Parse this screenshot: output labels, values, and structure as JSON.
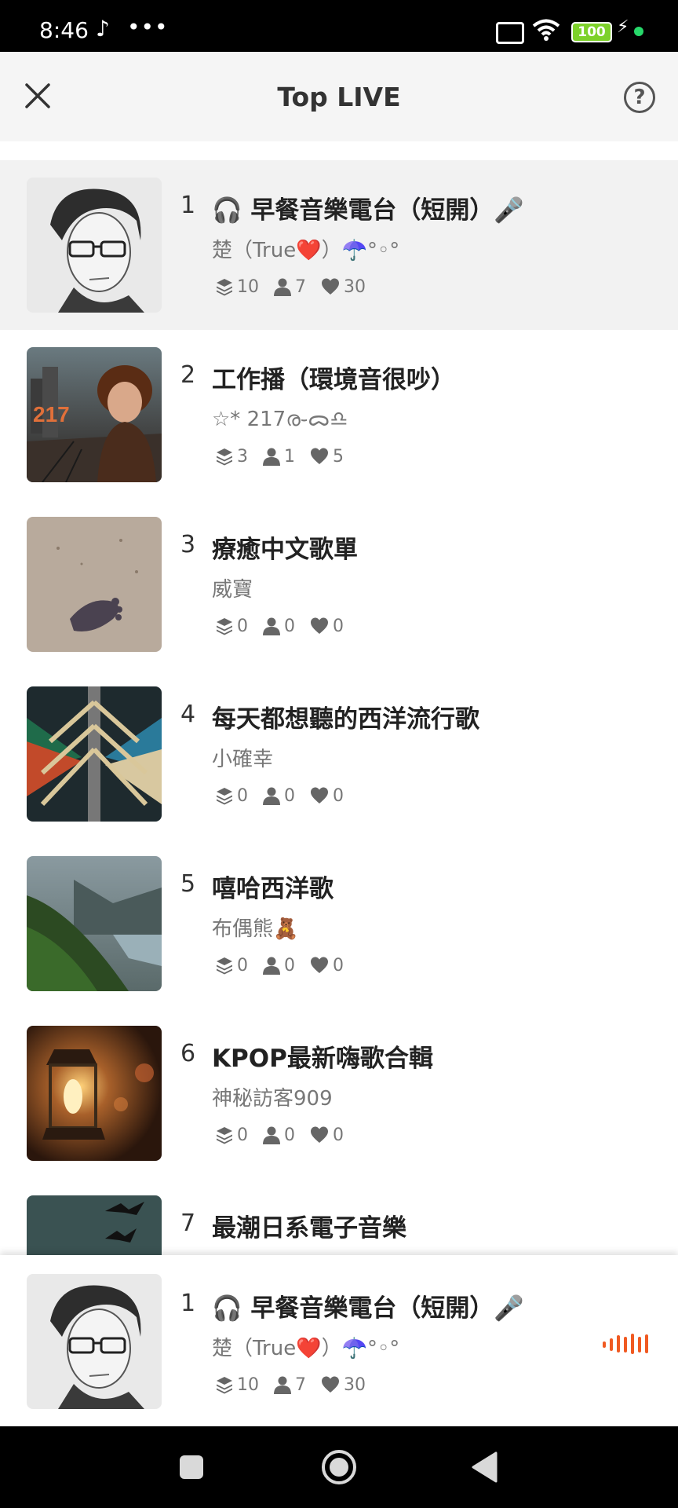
{
  "status_bar": {
    "time": "8:46",
    "tiktok_glyph": "♪",
    "more_dots": "•••",
    "battery": "100"
  },
  "header": {
    "title": "Top LIVE",
    "help_glyph": "?"
  },
  "rooms": [
    {
      "rank": "1",
      "title": "🎧 早餐音樂電台（短開）🎤",
      "host": "楚（True❤️）☂️°◦°",
      "layers": "10",
      "listeners": "7",
      "likes": "30"
    },
    {
      "rank": "2",
      "title": "工作播（環境音很吵）",
      "host": "☆* 217ര֊ᯅ♎",
      "layers": "3",
      "listeners": "1",
      "likes": "5"
    },
    {
      "rank": "3",
      "title": "療癒中文歌單",
      "host": "威寶",
      "layers": "0",
      "listeners": "0",
      "likes": "0"
    },
    {
      "rank": "4",
      "title": "每天都想聽的西洋流行歌",
      "host": "小確幸",
      "layers": "0",
      "listeners": "0",
      "likes": "0"
    },
    {
      "rank": "5",
      "title": "嘻哈西洋歌",
      "host": "布偶熊🧸",
      "layers": "0",
      "listeners": "0",
      "likes": "0"
    },
    {
      "rank": "6",
      "title": "KPOP最新嗨歌合輯",
      "host": "神秘訪客909",
      "layers": "0",
      "listeners": "0",
      "likes": "0"
    },
    {
      "rank": "7",
      "title": "最潮日系電子音樂",
      "host": "",
      "layers": "",
      "listeners": "",
      "likes": ""
    }
  ],
  "now_playing": {
    "rank": "1",
    "title": "🎧 早餐音樂電台（短開）🎤",
    "host": "楚（True❤️）☂️°◦°",
    "layers": "10",
    "listeners": "7",
    "likes": "30"
  },
  "colors": {
    "accent": "#f05a22",
    "highlight_row": "#f2f2f2",
    "battery": "#7dd12a"
  },
  "icons": [
    "close-icon",
    "help-icon",
    "layers-icon",
    "person-icon",
    "heart-icon",
    "equalizer-icon",
    "nav-square-icon",
    "nav-home-icon",
    "nav-back-icon"
  ]
}
